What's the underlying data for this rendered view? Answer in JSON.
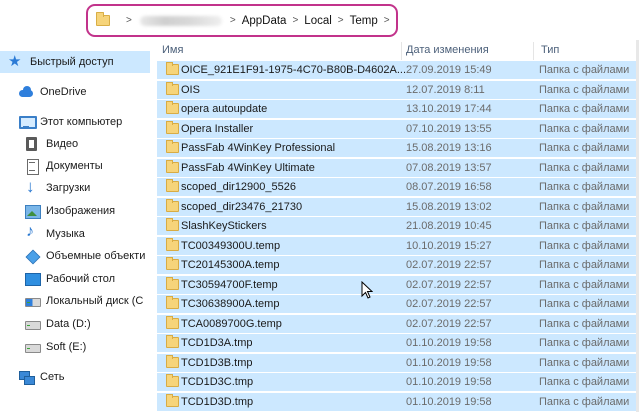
{
  "address": {
    "crumbs": [
      "AppData",
      "Local",
      "Temp"
    ],
    "chevron": ">",
    "blurred_segment": "obscured username"
  },
  "columns": {
    "name": "Имя",
    "date": "Дата изменения",
    "type": "Тип"
  },
  "nav": {
    "items": [
      {
        "label": "Быстрый доступ",
        "icon": "star-icon"
      },
      {
        "label": "OneDrive",
        "icon": "cloud-icon"
      },
      {
        "label": "Этот компьютер",
        "icon": "computer-icon"
      },
      {
        "label": "Видео",
        "icon": "video-icon"
      },
      {
        "label": "Документы",
        "icon": "documents-icon"
      },
      {
        "label": "Загрузки",
        "icon": "download-icon"
      },
      {
        "label": "Изображения",
        "icon": "pictures-icon"
      },
      {
        "label": "Музыка",
        "icon": "music-icon"
      },
      {
        "label": "Объемные объекти",
        "icon": "3d-objects-icon"
      },
      {
        "label": "Рабочий стол",
        "icon": "desktop-icon"
      },
      {
        "label": "Локальный диск (C",
        "icon": "drive-c-icon"
      },
      {
        "label": "Data (D:)",
        "icon": "drive-d-icon"
      },
      {
        "label": "Soft (E:)",
        "icon": "drive-e-icon"
      },
      {
        "label": "Сеть",
        "icon": "network-icon"
      }
    ]
  },
  "files": [
    {
      "name": "OICE_921E1F91-1975-4C70-B80B-D4602A...",
      "date": "27.09.2019 15:49",
      "type": "Папка с файлами"
    },
    {
      "name": "OIS",
      "date": "12.07.2019 8:11",
      "type": "Папка с файлами"
    },
    {
      "name": "opera autoupdate",
      "date": "13.10.2019 17:44",
      "type": "Папка с файлами"
    },
    {
      "name": "Opera Installer",
      "date": "07.10.2019 13:55",
      "type": "Папка с файлами"
    },
    {
      "name": "PassFab 4WinKey Professional",
      "date": "15.08.2019 13:16",
      "type": "Папка с файлами"
    },
    {
      "name": "PassFab 4WinKey Ultimate",
      "date": "07.08.2019 13:57",
      "type": "Папка с файлами"
    },
    {
      "name": "scoped_dir12900_5526",
      "date": "08.07.2019 16:58",
      "type": "Папка с файлами"
    },
    {
      "name": "scoped_dir23476_21730",
      "date": "15.08.2019 13:02",
      "type": "Папка с файлами"
    },
    {
      "name": "SlashKeyStickers",
      "date": "21.08.2019 10:45",
      "type": "Папка с файлами"
    },
    {
      "name": "TC00349300U.temp",
      "date": "10.10.2019 15:27",
      "type": "Папка с файлами"
    },
    {
      "name": "TC20145300A.temp",
      "date": "02.07.2019 22:57",
      "type": "Папка с файлами"
    },
    {
      "name": "TC30594700F.temp",
      "date": "02.07.2019 22:57",
      "type": "Папка с файлами"
    },
    {
      "name": "TC30638900A.temp",
      "date": "02.07.2019 22:57",
      "type": "Папка с файлами"
    },
    {
      "name": "TCA0089700G.temp",
      "date": "02.07.2019 22:57",
      "type": "Папка с файлами"
    },
    {
      "name": "TCD1D3A.tmp",
      "date": "01.10.2019 19:58",
      "type": "Папка с файлами"
    },
    {
      "name": "TCD1D3B.tmp",
      "date": "01.10.2019 19:58",
      "type": "Папка с файлами"
    },
    {
      "name": "TCD1D3C.tmp",
      "date": "01.10.2019 19:58",
      "type": "Папка с файлами"
    },
    {
      "name": "TCD1D3D.tmp",
      "date": "01.10.2019 19:58",
      "type": "Папка с файлами"
    }
  ],
  "colors": {
    "selection": "#cce8ff",
    "highlight_border": "#c2338b",
    "folder": "#f6d47a"
  }
}
